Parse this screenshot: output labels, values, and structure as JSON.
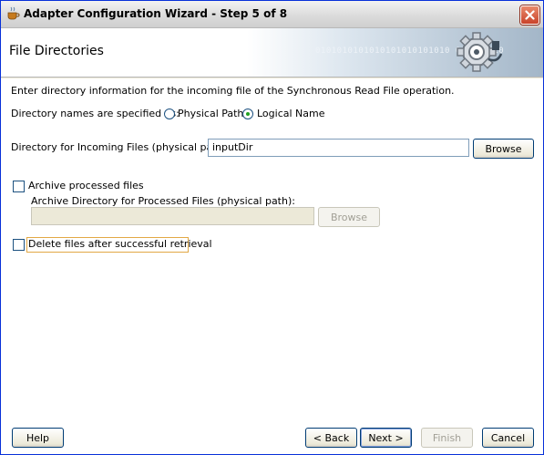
{
  "window": {
    "title": "Adapter Configuration Wizard - Step 5 of 8",
    "app_icon": "oracle-jdeveloper-cup-icon",
    "close_icon": "close-icon"
  },
  "header": {
    "title": "File Directories",
    "binary_text": "0101010101010101010101010 010101010",
    "graphic_icon": "gear-plug-icon"
  },
  "content": {
    "intro": "Enter directory information for the incoming file of the Synchronous Read File operation.",
    "names_label": "Directory names are specified as:",
    "radio_physical": "Physical Path",
    "radio_logical": "Logical Name",
    "selected": "Logical Name",
    "incoming_label": "Directory for Incoming Files (physical path):",
    "incoming_value": "inputDir",
    "browse1": "Browse",
    "archive_checkbox": "Archive processed files",
    "archive_checked": false,
    "archive_dir_label": "Archive Directory for Processed Files (physical path):",
    "archive_dir_value": "",
    "browse2": "Browse",
    "delete_checkbox": "Delete files after successful retrieval",
    "delete_checked": false
  },
  "footer": {
    "help": "Help",
    "back": "< Back",
    "next": "Next >",
    "finish": "Finish",
    "cancel": "Cancel"
  }
}
